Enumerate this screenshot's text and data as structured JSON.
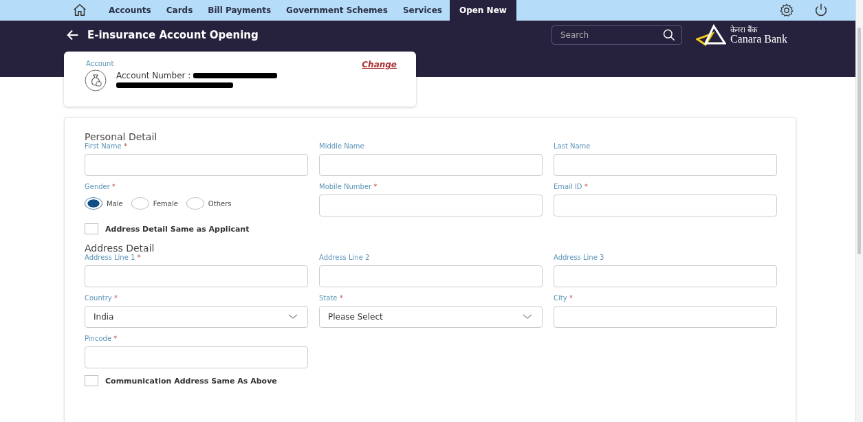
{
  "nav": {
    "items": [
      {
        "label": "Accounts",
        "selected": false
      },
      {
        "label": "Cards",
        "selected": false
      },
      {
        "label": "Bill Payments",
        "selected": false
      },
      {
        "label": "Government Schemes",
        "selected": false
      },
      {
        "label": "Services",
        "selected": false
      },
      {
        "label": "Open New",
        "selected": true
      }
    ]
  },
  "header": {
    "title": "E-insurance Account Opening",
    "search": {
      "placeholder": "Search"
    },
    "logo": {
      "hindi": "केनरा बैंक",
      "name": "Canara Bank"
    }
  },
  "account": {
    "label": "Account",
    "change": "Change",
    "number_label": "Account Number :"
  },
  "sections": [
    {
      "title": "Personal Detail",
      "rows": [
        [
          {
            "kind": "text",
            "label": "First Name",
            "required_mark": "*"
          },
          {
            "kind": "text",
            "label": "Middle Name"
          },
          {
            "kind": "text",
            "label": "Last Name"
          }
        ],
        [
          {
            "kind": "radio",
            "label": "Gender",
            "required_mark": "*",
            "options": [
              {
                "label": "Male",
                "selected": true
              },
              {
                "label": "Female",
                "selected": false
              },
              {
                "label": "Others",
                "selected": false
              }
            ]
          },
          {
            "kind": "text",
            "label": "Mobile Number",
            "required_mark": "*"
          },
          {
            "kind": "text",
            "label": "Email ID",
            "required_mark": "*"
          }
        ]
      ],
      "checkbox": {
        "label": "Address Detail Same as Applicant",
        "checked": false
      }
    },
    {
      "title": "Address Detail",
      "rows": [
        [
          {
            "kind": "text",
            "label": "Address Line 1",
            "required_mark": "*"
          },
          {
            "kind": "text",
            "label": "Address Line 2"
          },
          {
            "kind": "text",
            "label": "Address Line 3"
          }
        ],
        [
          {
            "kind": "select",
            "label": "Country",
            "required_mark": "*",
            "value": "India"
          },
          {
            "kind": "select",
            "label": "State",
            "required_mark": "*",
            "value": "Please Select"
          },
          {
            "kind": "text",
            "label": "City",
            "required_mark": "*"
          }
        ],
        [
          {
            "kind": "text",
            "label": "Pincode",
            "required_mark": "*"
          }
        ]
      ],
      "checkbox": {
        "label": "Communication Address Same As Above",
        "checked": false
      }
    }
  ]
}
